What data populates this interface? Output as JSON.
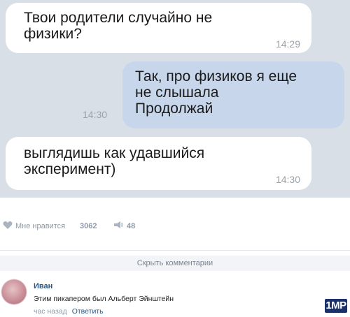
{
  "messages": [
    {
      "text": "Твои родители случайно не\nфизики?",
      "time": "14:29",
      "direction": "incoming"
    },
    {
      "text": "Так, про физиков я еще\nне слышала\nПродолжай",
      "time": "14:30",
      "direction": "outgoing"
    },
    {
      "text": "выглядишь как удавшийся\nэксперимент)",
      "time": "14:30",
      "direction": "incoming"
    }
  ],
  "post_footer": {
    "like_label": "Мне нравится",
    "like_count": "3062",
    "share_count": "48"
  },
  "hide_comments_label": "Скрыть комментарии",
  "comment": {
    "author": "Иван",
    "text": "Этим пикапером был Альберт Эйнштейн",
    "time": "час назад",
    "reply_label": "Ответить"
  },
  "watermark": "1MP",
  "colors": {
    "chat_background": "#d9dfe7",
    "incoming_bubble": "#ffffff",
    "outgoing_bubble": "#c7d6ea",
    "link": "#2a5885"
  }
}
